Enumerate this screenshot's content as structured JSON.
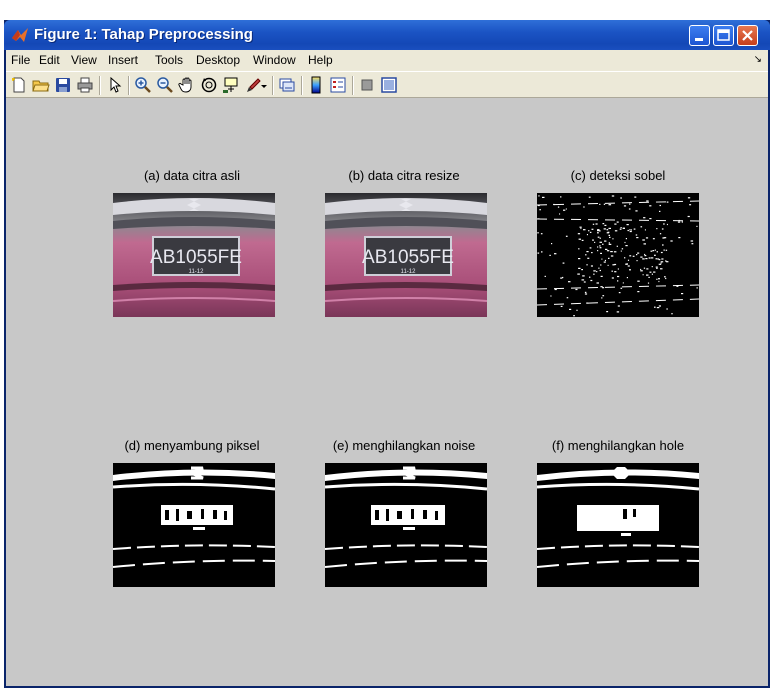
{
  "window": {
    "title": "Figure 1: Tahap Preprocessing"
  },
  "menu": [
    "File",
    "Edit",
    "View",
    "Insert",
    "Tools",
    "Desktop",
    "Window",
    "Help"
  ],
  "toolbar_icons": [
    "new-figure-icon",
    "open-file-icon",
    "save-icon",
    "print-icon",
    "edit-plot-arrow-icon",
    "zoom-in-icon",
    "zoom-out-icon",
    "pan-hand-icon",
    "rotate-3d-icon",
    "data-cursor-icon",
    "brush-icon",
    "brush-dropdown-icon",
    "link-plot-icon",
    "insert-colorbar-icon",
    "insert-legend-icon",
    "hide-plot-tools-icon",
    "show-plot-tools-icon"
  ],
  "panels": [
    {
      "caption": "(a) data citra asli",
      "kind": "photo",
      "plate": "AB1055FE",
      "plate_sub": "11-12"
    },
    {
      "caption": "(b) data citra resize",
      "kind": "photo",
      "plate": "AB1055FE",
      "plate_sub": "11-12"
    },
    {
      "caption": "(c) deteksi sobel",
      "kind": "sobel"
    },
    {
      "caption": "(d) menyambung piksel",
      "kind": "binary"
    },
    {
      "caption": "(e) menghilangkan noise",
      "kind": "binary"
    },
    {
      "caption": "(f) menghilangkan hole",
      "kind": "filled"
    }
  ],
  "colors": {
    "figure_bg": "#c8c8c8",
    "titlebar": "#1b54c4",
    "menubar": "#ece9d8",
    "car_body": "#b0587e"
  }
}
